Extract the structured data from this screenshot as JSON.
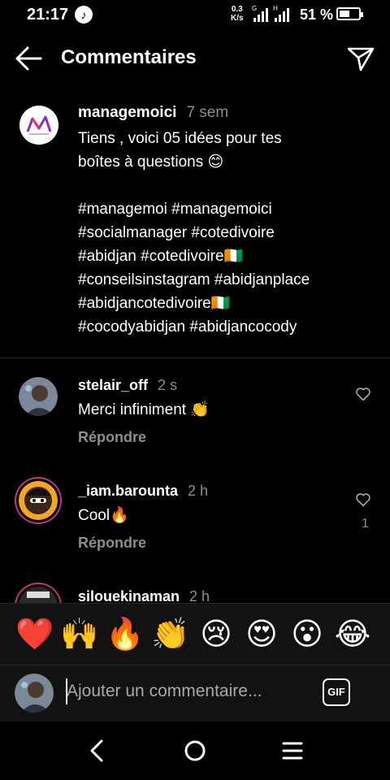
{
  "status_bar": {
    "time": "21:17",
    "app_icon": "tiktok-icon",
    "net_speed_top": "0.3",
    "net_speed_bottom": "K/s",
    "signal1_label": "G",
    "signal2_label": "H",
    "battery_percent": "51 %"
  },
  "header": {
    "title": "Commentaires",
    "back_icon": "back-arrow-icon",
    "share_icon": "send-icon"
  },
  "caption": {
    "username": "managemoici",
    "time": "7 sem",
    "lines": [
      "Tiens , voici 05 idées pour tes",
      "boîtes à questions 😊",
      "",
      "#managemoi #managemoici",
      "#socialmanager #cotedivoire",
      "#abidjan #cotedivoire🇨🇮",
      "#conseilsinstagram #abidjanplace",
      "#abidjancotedivoire🇨🇮",
      "#cocodyabidjan #abidjancocody"
    ]
  },
  "comments": [
    {
      "username": "stelair_off",
      "time": "2 s",
      "text": "Merci infiniment 👏",
      "reply": "Répondre",
      "likes": ""
    },
    {
      "username": "_iam.barounta",
      "time": "2 h",
      "text": "Cool🔥",
      "reply": "Répondre",
      "likes": "1"
    },
    {
      "username": "silouekinaman",
      "time": "2 h",
      "text": "",
      "reply": "",
      "likes": ""
    }
  ],
  "emoji_bar": [
    "❤️",
    "🙌",
    "🔥",
    "👏",
    "😢",
    "😍",
    "😮",
    "😂"
  ],
  "composer": {
    "placeholder": "Ajouter un commentaire...",
    "gif_label": "GIF"
  },
  "colors": {
    "background": "#000000",
    "secondary_text": "#8e8e8e",
    "story_ring": "#c13584"
  }
}
